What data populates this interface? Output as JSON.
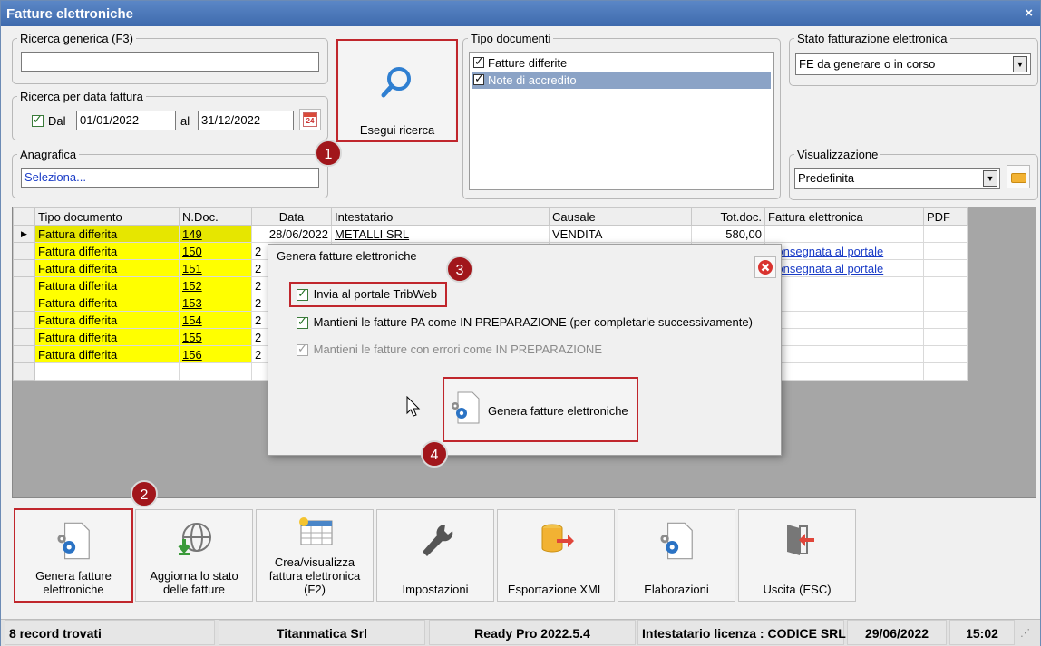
{
  "window": {
    "title": "Fatture elettroniche",
    "close_glyph": "×"
  },
  "search": {
    "generic_label": "Ricerca generica (F3)",
    "generic_value": "",
    "date_label": "Ricerca per data fattura",
    "dal_label": "Dal",
    "date_from": "01/01/2022",
    "al_label": "al",
    "date_to": "31/12/2022",
    "calendar_day": "24",
    "anagrafica_label": "Anagrafica",
    "anagrafica_value": "Seleziona...",
    "button_label": "Esegui ricerca"
  },
  "tipo_documenti": {
    "label": "Tipo documenti",
    "items": [
      "Fatture differite",
      "Note di accredito"
    ]
  },
  "stato_fe": {
    "label": "Stato fatturazione elettronica",
    "selected": "FE da generare o in corso"
  },
  "visualizzazione": {
    "label": "Visualizzazione",
    "selected": "Predefinita"
  },
  "badges": {
    "b1": "1",
    "b2": "2",
    "b3": "3",
    "b4": "4"
  },
  "grid": {
    "columns": [
      "Tipo documento",
      "N.Doc.",
      "Data",
      "Intestatario",
      "Causale",
      "Tot.doc.",
      "Fattura elettronica",
      "PDF"
    ],
    "rows": [
      {
        "tipo": "Fattura differita",
        "ndoc": "149",
        "data": "28/06/2022",
        "intestatario": "METALLI SRL",
        "causale": "VENDITA",
        "tot": "580,00",
        "fe": ""
      },
      {
        "tipo": "Fattura differita",
        "ndoc": "150",
        "data": "2",
        "intestatario": "",
        "causale": "",
        "tot": "",
        "fe": "Consegnata al portale"
      },
      {
        "tipo": "Fattura differita",
        "ndoc": "151",
        "data": "2",
        "intestatario": "",
        "causale": "",
        "tot": "",
        "fe": "Consegnata al portale"
      },
      {
        "tipo": "Fattura differita",
        "ndoc": "152",
        "data": "2",
        "intestatario": "",
        "causale": "",
        "tot": "",
        "fe": ""
      },
      {
        "tipo": "Fattura differita",
        "ndoc": "153",
        "data": "2",
        "intestatario": "",
        "causale": "",
        "tot": "",
        "fe": ""
      },
      {
        "tipo": "Fattura differita",
        "ndoc": "154",
        "data": "2",
        "intestatario": "",
        "causale": "",
        "tot": "",
        "fe": ""
      },
      {
        "tipo": "Fattura differita",
        "ndoc": "155",
        "data": "2",
        "intestatario": "",
        "causale": "",
        "tot": "",
        "fe": ""
      },
      {
        "tipo": "Fattura differita",
        "ndoc": "156",
        "data": "2",
        "intestatario": "",
        "causale": "",
        "tot": "",
        "fe": ""
      }
    ]
  },
  "dialog": {
    "title": "Genera fatture elettroniche",
    "opt1": "Invia al portale TribWeb",
    "opt2": "Mantieni le fatture PA come IN PREPARAZIONE (per completarle successivamente)",
    "opt3": "Mantieni le fatture con errori come IN PREPARAZIONE",
    "button_label": "Genera fatture elettroniche"
  },
  "toolbar": {
    "genera": [
      "Genera fatture",
      "elettroniche"
    ],
    "aggiorna": [
      "Aggiorna lo stato",
      "delle fatture"
    ],
    "crea": [
      "Crea/visualizza",
      "fattura elettronica",
      "(F2)"
    ],
    "impostazioni": "Impostazioni",
    "esportazione": "Esportazione XML",
    "elaborazioni": "Elaborazioni",
    "uscita": "Uscita (ESC)"
  },
  "status": {
    "records": "8 record trovati",
    "company": "Titanmatica Srl",
    "version": "Ready Pro 2022.5.4",
    "license": "Intestatario licenza : CODICE SRL",
    "date": "29/06/2022",
    "time": "15:02"
  },
  "colors": {
    "accent_red": "#c0262c",
    "badge_red": "#a1161b",
    "row_yellow": "#ffff00",
    "titlebar_blue": "#4a78bb"
  }
}
